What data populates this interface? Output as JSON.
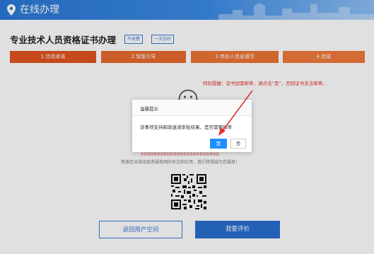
{
  "header": {
    "title": "在线办理"
  },
  "page": {
    "title": "专业技术人员资格证书办理",
    "tags": [
      "不收费",
      "一次办好"
    ]
  },
  "steps": [
    "1.信用承诺",
    "2.智能引导",
    "3.申办人信息填写",
    "4.完成"
  ],
  "notice": "特别提醒：证书如需邮寄，请点击“是”，否则证书无法邮寄。",
  "result": {
    "code_line": "000000000000000000000000",
    "thanks": "感谢您对湖北政务服务网的关注和应用，我们将竭诚为您服务！"
  },
  "buttons": {
    "back": "返回用户空间",
    "rate": "我要评价"
  },
  "dialog": {
    "title": "温馨提示",
    "message": "该事项支持邮政速递审批结果，是否需要邮寄",
    "yes": "是",
    "no": "否"
  },
  "colors": {
    "header": "#2a78d6",
    "step_dark": "#e0551f",
    "step_light": "#f07a3c",
    "alert": "#e53030",
    "primary": "#2a6fd0"
  }
}
